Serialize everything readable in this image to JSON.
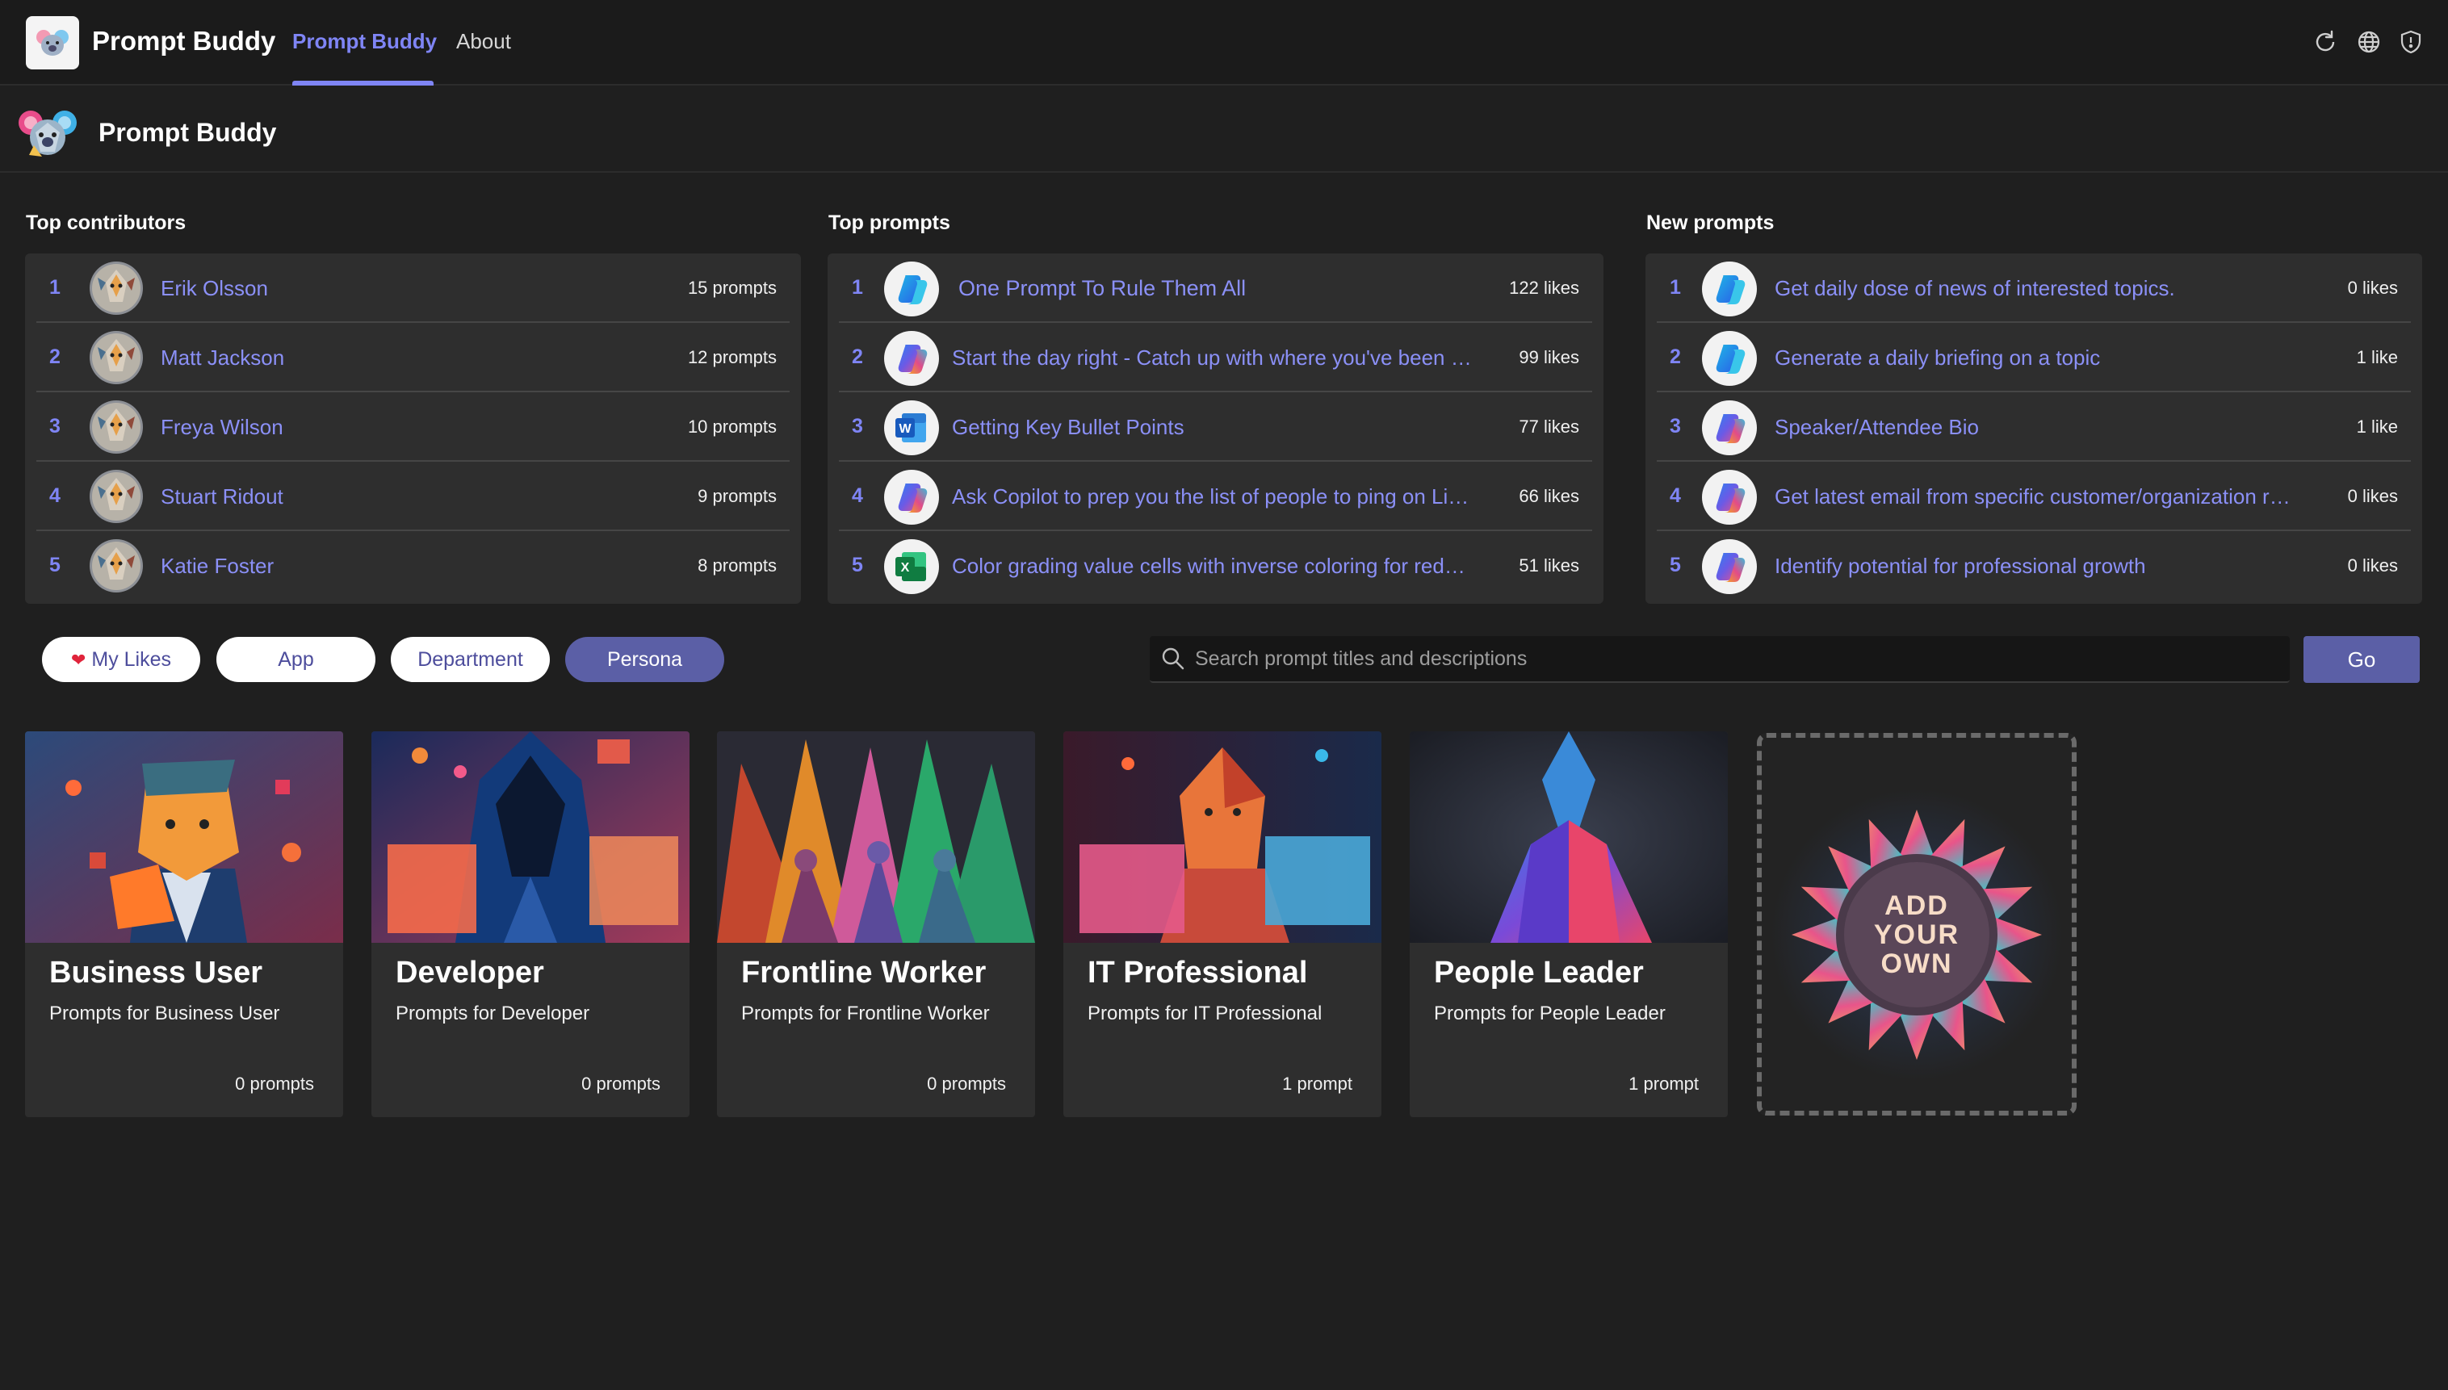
{
  "app": {
    "title": "Prompt Buddy",
    "tabs": [
      {
        "label": "Prompt Buddy",
        "active": true
      },
      {
        "label": "About",
        "active": false
      }
    ],
    "accent_color": "#7f85f5",
    "icons": [
      "refresh-icon",
      "globe-icon",
      "shield-icon"
    ]
  },
  "page": {
    "title": "Prompt Buddy"
  },
  "leaderboards": {
    "contributors": {
      "title": "Top contributors",
      "rows": [
        {
          "rank": "1",
          "name": "Erik Olsson",
          "meta": "15 prompts"
        },
        {
          "rank": "2",
          "name": "Matt Jackson",
          "meta": "12 prompts"
        },
        {
          "rank": "3",
          "name": "Freya Wilson",
          "meta": "10 prompts"
        },
        {
          "rank": "4",
          "name": "Stuart Ridout",
          "meta": "9 prompts"
        },
        {
          "rank": "5",
          "name": "Katie Foster",
          "meta": "8 prompts"
        }
      ]
    },
    "top_prompts": {
      "title": "Top prompts",
      "rows": [
        {
          "rank": "1",
          "name": "One Prompt To Rule Them All",
          "meta": "122 likes",
          "icon": "copilot-blue-icon"
        },
        {
          "rank": "2",
          "name": "Start the day right - Catch up with where you've been m...",
          "meta": "99 likes",
          "icon": "copilot-icon"
        },
        {
          "rank": "3",
          "name": "Getting Key Bullet Points",
          "meta": "77 likes",
          "icon": "word-icon"
        },
        {
          "rank": "4",
          "name": "Ask Copilot to prep you the list of people to ping on Lin...",
          "meta": "66 likes",
          "icon": "copilot-icon"
        },
        {
          "rank": "5",
          "name": "Color grading value cells with inverse coloring for reduci...",
          "meta": "51 likes",
          "icon": "excel-icon"
        }
      ]
    },
    "new_prompts": {
      "title": "New prompts",
      "rows": [
        {
          "rank": "1",
          "name": "Get daily dose of news of interested topics.",
          "meta": "0 likes",
          "icon": "copilot-blue-icon"
        },
        {
          "rank": "2",
          "name": "Generate a daily briefing on a topic",
          "meta": "1 like",
          "icon": "copilot-blue-icon"
        },
        {
          "rank": "3",
          "name": "Speaker/Attendee Bio",
          "meta": "1 like",
          "icon": "copilot-icon"
        },
        {
          "rank": "4",
          "name": "Get latest email from specific customer/organization rec...",
          "meta": "0 likes",
          "icon": "copilot-icon"
        },
        {
          "rank": "5",
          "name": "Identify potential for professional growth",
          "meta": "0 likes",
          "icon": "copilot-icon"
        }
      ]
    }
  },
  "filters": {
    "pills": [
      {
        "label": "My Likes",
        "icon": "heart-icon",
        "active": false
      },
      {
        "label": "App",
        "active": false
      },
      {
        "label": "Department",
        "active": false
      },
      {
        "label": "Persona",
        "active": true
      }
    ],
    "search": {
      "placeholder": "Search prompt titles and descriptions",
      "value": ""
    },
    "go_label": "Go"
  },
  "personas": [
    {
      "title": "Business User",
      "description": "Prompts for Business User",
      "count": "0 prompts"
    },
    {
      "title": "Developer",
      "description": "Prompts for Developer",
      "count": "0 prompts"
    },
    {
      "title": "Frontline Worker",
      "description": "Prompts for Frontline Worker",
      "count": "0 prompts"
    },
    {
      "title": "IT Professional",
      "description": "Prompts for IT Professional",
      "count": "1 prompt"
    },
    {
      "title": "People Leader",
      "description": "Prompts for People Leader",
      "count": "1 prompt"
    }
  ],
  "add_card": {
    "line1": "ADD",
    "line2": "YOUR",
    "line3": "OWN"
  }
}
